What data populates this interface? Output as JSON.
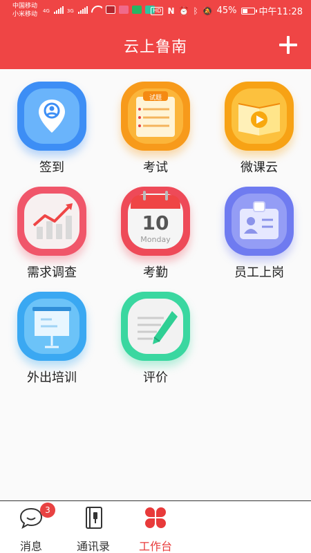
{
  "status_bar": {
    "carrier_1": "中国移动",
    "carrier_2": "小米移动",
    "network_tag": "4G",
    "network_tag_2": "3G",
    "hd_label": "HD",
    "battery": "45%",
    "time": "中午11:28"
  },
  "header": {
    "title": "云上鲁南",
    "add_icon": "plus-icon",
    "color": "#ef4545"
  },
  "apps": [
    {
      "label": "签到",
      "icon": "location-pin-icon",
      "color": "#3d8ef5"
    },
    {
      "label": "考试",
      "icon": "exam-paper-icon",
      "color": "#f79a1b",
      "badge_text": "试题"
    },
    {
      "label": "微课云",
      "icon": "video-book-icon",
      "color": "#f7a215"
    },
    {
      "label": "需求调查",
      "icon": "trend-chart-icon",
      "color": "#f0566a"
    },
    {
      "label": "考勤",
      "icon": "calendar-icon",
      "color": "#ee4a58",
      "calendar_day": "10",
      "calendar_weekday": "Monday"
    },
    {
      "label": "员工上岗",
      "icon": "id-card-icon",
      "color": "#6f7bf0"
    },
    {
      "label": "外出培训",
      "icon": "presentation-board-icon",
      "color": "#3aa8f2"
    },
    {
      "label": "评价",
      "icon": "edit-note-icon",
      "color": "#3ad7a0"
    }
  ],
  "tabbar": {
    "tabs": [
      {
        "label": "消息",
        "icon": "chat-bubble-icon",
        "badge": "3",
        "active": false
      },
      {
        "label": "通讯录",
        "icon": "contacts-book-icon",
        "active": false
      },
      {
        "label": "工作台",
        "icon": "workbench-icon",
        "active": true
      }
    ],
    "active_color": "#e83a3a"
  }
}
